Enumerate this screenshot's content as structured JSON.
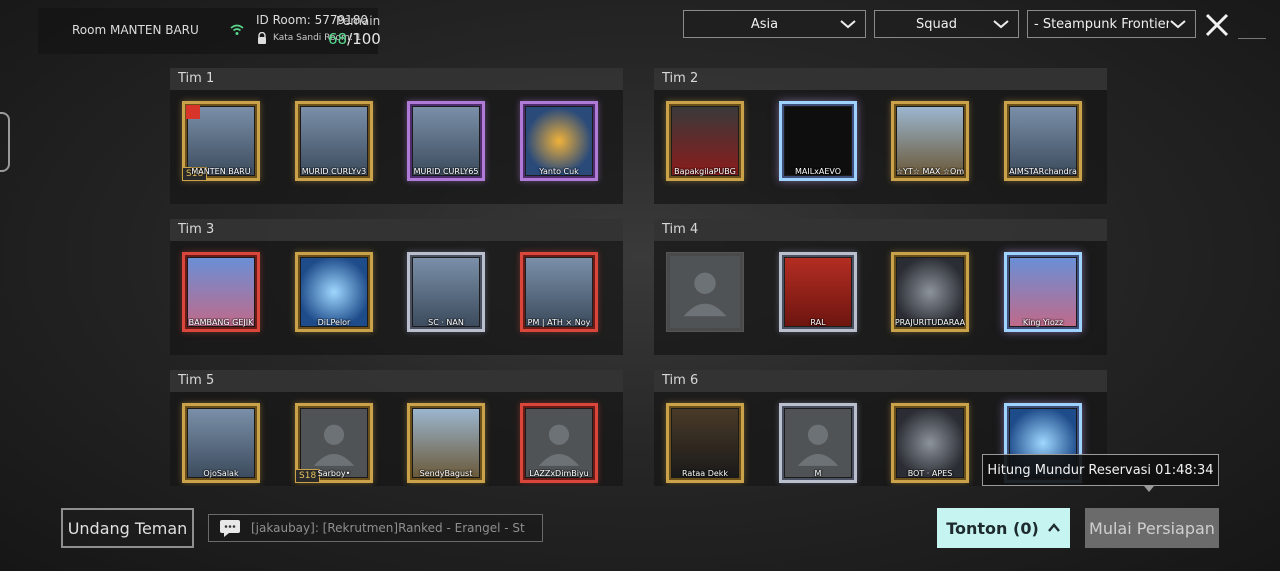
{
  "room": {
    "name": "Room MANTEN  BARU",
    "id_text": "ID Room: 5779180",
    "password_text": "Kata Sandi Room: 1",
    "players_label": "Pemain",
    "players_current": "68",
    "players_max": "/100"
  },
  "filters": {
    "region": "Asia",
    "mode": "Squad",
    "map": "- Steampunk Frontier"
  },
  "teams": [
    {
      "label": "Tim 1",
      "players": [
        {
          "name": "MANTEN  BARU",
          "frame": "gold",
          "host": true,
          "badge": "S18",
          "icon": "player-photo-icon"
        },
        {
          "name": "MURID  CURLYv3",
          "frame": "gold",
          "icon": "player-photo-icon"
        },
        {
          "name": "MURID  CURLY65",
          "frame": "purple",
          "icon": "player-photo-icon"
        },
        {
          "name": "Yanto  Cuk",
          "frame": "purple",
          "icon": "emblem-icon"
        }
      ]
    },
    {
      "label": "Tim 2",
      "players": [
        {
          "name": "BapakgilaPUBG",
          "frame": "gold",
          "icon": "godzilla-logo-icon"
        },
        {
          "name": "MAILxAEVO",
          "frame": "cyan",
          "icon": "aevo-logo-icon"
        },
        {
          "name": "☆YT☆ MAX ☆Om",
          "frame": "gold",
          "icon": "monument-icon"
        },
        {
          "name": "AIMSTARchandra",
          "frame": "gold",
          "icon": "player-photo-icon"
        }
      ]
    },
    {
      "label": "Tim 3",
      "players": [
        {
          "name": "BAMBANG  GEJIK",
          "frame": "red",
          "icon": "anime-avatar-icon"
        },
        {
          "name": "DiLPelor",
          "frame": "gold",
          "icon": "snowflake-icon"
        },
        {
          "name": "SC · NAN",
          "frame": "silver",
          "icon": "player-photo-icon"
        },
        {
          "name": "PM  |  ATH × Noy",
          "frame": "red",
          "icon": "player-photo-icon"
        }
      ]
    },
    {
      "label": "Tim 4",
      "players": [
        {
          "name": "",
          "frame": "empty",
          "icon": "default-avatar-icon"
        },
        {
          "name": "RAL",
          "frame": "silver",
          "icon": "horseshoe-icon"
        },
        {
          "name": "PRAJURITUDARAA",
          "frame": "gold",
          "icon": "helmet-icon"
        },
        {
          "name": "King   Yiozz",
          "frame": "cyan",
          "icon": "anime-avatar-icon"
        }
      ]
    },
    {
      "label": "Tim 5",
      "players": [
        {
          "name": "OjoSalak",
          "frame": "gold",
          "icon": "player-photo-icon"
        },
        {
          "name": "Sarboy•",
          "frame": "gold",
          "badge": "S18",
          "icon": "default-avatar-icon"
        },
        {
          "name": "SendyBagust",
          "frame": "gold",
          "icon": "monument-icon"
        },
        {
          "name": "LAZZxDimBiyu",
          "frame": "red",
          "icon": "default-avatar-icon"
        }
      ]
    },
    {
      "label": "Tim 6",
      "players": [
        {
          "name": "Rataa    Dekk",
          "frame": "gold",
          "icon": "trophy-icon"
        },
        {
          "name": "M",
          "frame": "silver",
          "icon": "default-avatar-icon"
        },
        {
          "name": "BOT · APES",
          "frame": "gold",
          "icon": "helmet-icon"
        },
        {
          "name": "",
          "frame": "cyan",
          "icon": "snowflake-icon"
        }
      ]
    }
  ],
  "bottom": {
    "invite_label": "Undang Teman",
    "chat_text": "[jakaubay]: [Rekrutmen]Ranked - Erangel - St",
    "watch_label": "Tonton (0)",
    "ready_label": "Mulai Persiapan",
    "countdown_text": "Hitung Mundur Reservasi 01:48:34"
  },
  "colors": {
    "players_current": "#58d68d",
    "watch_button": "#c6f4f1",
    "gold_frame": "#c9a24a",
    "red_frame": "#d9463b"
  }
}
